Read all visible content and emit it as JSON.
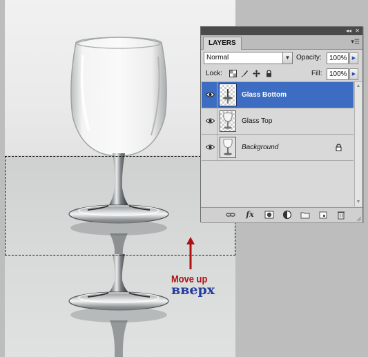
{
  "panel": {
    "tab_label": "LAYERS",
    "blend_mode": "Normal",
    "opacity_label": "Opacity:",
    "opacity_value": "100%",
    "lock_label": "Lock:",
    "fill_label": "Fill:",
    "fill_value": "100%",
    "layers": [
      {
        "name": "Glass Bottom",
        "selected": true,
        "visible": true
      },
      {
        "name": "Glass Top",
        "selected": false,
        "visible": true
      },
      {
        "name": "Background",
        "selected": false,
        "visible": true,
        "locked": true
      }
    ],
    "bottom_icons": [
      "link-icon",
      "fx-icon",
      "mask-icon",
      "adjustment-icon",
      "group-folder-icon",
      "new-layer-icon",
      "trash-icon"
    ],
    "fx_label": "fx"
  },
  "annotation": {
    "english": "Move up",
    "russian": "вверх",
    "english_color": "#b01010",
    "russian_color": "#223c9c",
    "arrow_color": "#b01010"
  },
  "colors": {
    "selection_highlight": "#3c6dc2"
  }
}
